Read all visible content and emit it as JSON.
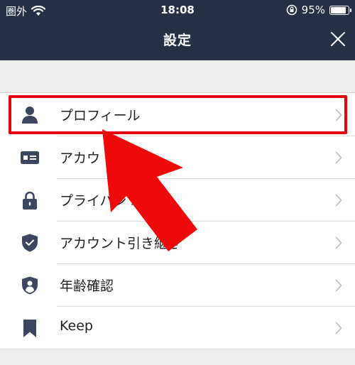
{
  "status_bar": {
    "carrier": "圏外",
    "time": "18:08",
    "battery": "95%"
  },
  "header": {
    "title": "設定"
  },
  "settings": {
    "items": [
      {
        "label": "プロフィール",
        "icon": "person-icon"
      },
      {
        "label": "アカウ",
        "icon": "id-card-icon"
      },
      {
        "label": "プライバシ 理",
        "icon": "lock-icon"
      },
      {
        "label": "アカウント引き継ぎ",
        "icon": "shield-check-icon"
      },
      {
        "label": "年齢確認",
        "icon": "shield-person-icon"
      },
      {
        "label": "Keep",
        "icon": "bookmark-icon"
      }
    ]
  },
  "colors": {
    "header_bg": "#253047",
    "icon": "#3b4660",
    "highlight": "#e8000f",
    "arrow": "#ee0a0a"
  }
}
